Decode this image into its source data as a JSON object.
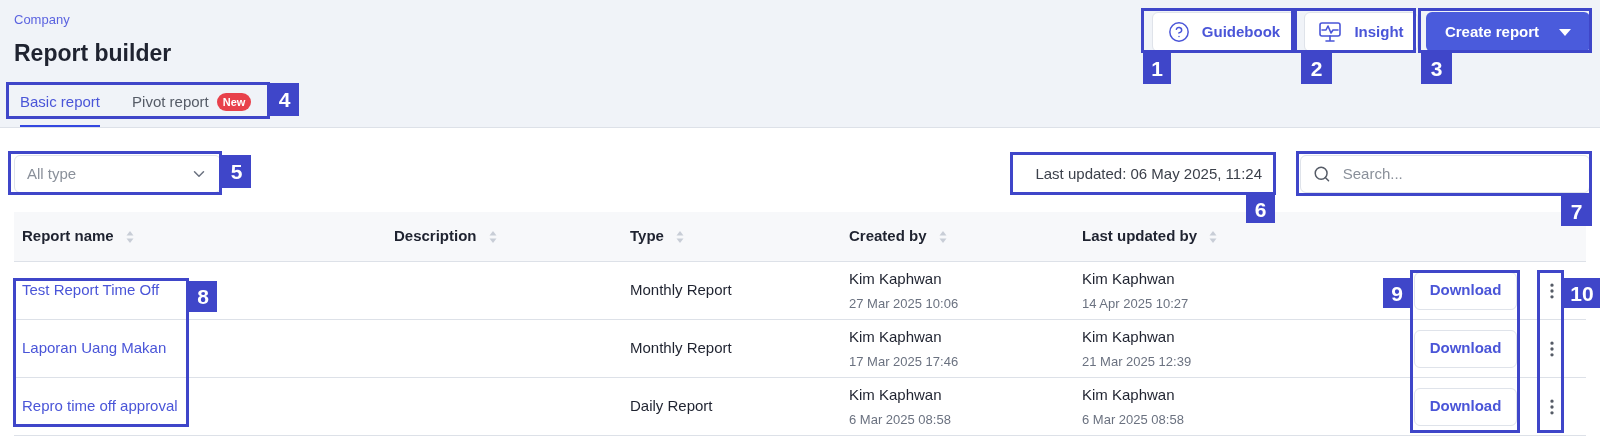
{
  "breadcrumb": "Company",
  "title": "Report builder",
  "header_buttons": [
    {
      "kind": "guide",
      "label": "Guidebook"
    },
    {
      "kind": "insight",
      "label": "Insight"
    },
    {
      "kind": "primary",
      "label": "Create report"
    }
  ],
  "tabs": [
    {
      "label": "Basic report",
      "selected": true
    },
    {
      "label": "Pivot report",
      "selected": false,
      "badge": "New"
    }
  ],
  "type_filter": {
    "placeholder": "All type"
  },
  "last_updated": "Last updated: 06 May 2025, 11:24",
  "search": {
    "placeholder": "Search..."
  },
  "table": {
    "columns": [
      "Report name",
      "Description",
      "Type",
      "Created by",
      "Last updated by"
    ],
    "rows": [
      {
        "report_name": "Test Report Time Off",
        "type": "Monthly Report",
        "created_by": "Kim Kaphwan",
        "created_at": "27 Mar 2025 10:06",
        "updated_by": "Kim Kaphwan",
        "updated_at": "14 Apr 2025 10:27",
        "action": "Download"
      },
      {
        "report_name": "Laporan Uang Makan",
        "type": "Monthly Report",
        "created_by": "Kim Kaphwan",
        "created_at": "17 Mar 2025 17:46",
        "updated_by": "Kim Kaphwan",
        "updated_at": "21 Mar 2025 12:39",
        "action": "Download"
      },
      {
        "report_name": "Repro time off approval",
        "type": "Daily Report",
        "created_by": "Kim Kaphwan",
        "created_at": "6 Mar 2025 08:58",
        "updated_by": "Kim Kaphwan",
        "updated_at": "6 Mar 2025 08:58",
        "action": "Download"
      }
    ]
  },
  "annotations": [
    {
      "number": "1"
    },
    {
      "number": "2"
    },
    {
      "number": "3"
    },
    {
      "number": "4"
    },
    {
      "number": "5"
    },
    {
      "number": "6"
    },
    {
      "number": "7"
    },
    {
      "number": "8"
    },
    {
      "number": "9"
    },
    {
      "number": "10"
    }
  ]
}
